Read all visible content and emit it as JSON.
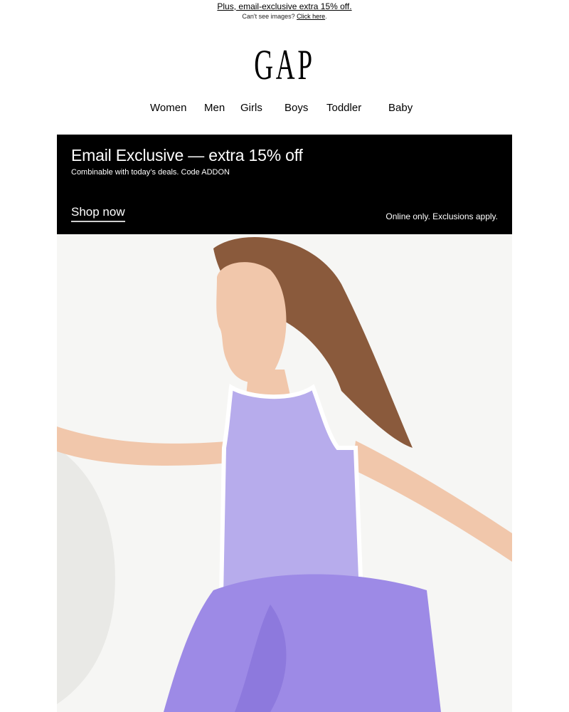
{
  "preheader": {
    "link_text": "Plus, email-exclusive extra 15% off.",
    "cant_see_text": "Can't see images?",
    "click_here": "Click here"
  },
  "logo": {
    "text": "GAP"
  },
  "nav": {
    "items": [
      "Women",
      "Men",
      "Girls",
      "Boys",
      "Toddler",
      "Baby"
    ]
  },
  "promo": {
    "title": "Email Exclusive — extra 15% off",
    "subtitle": "Combinable with today’s deals. Code ADDON",
    "cta": "Shop now",
    "note": "Online only. Exclusions apply.",
    "bg_color": "#000000",
    "text_color": "#ffffff"
  },
  "hero": {
    "colors": {
      "background": "#f6f6f4",
      "tank": "#b7acec",
      "sweater": "#9d8ae6",
      "hair": "#8a5a3c",
      "skin": "#f1c7ab"
    }
  }
}
